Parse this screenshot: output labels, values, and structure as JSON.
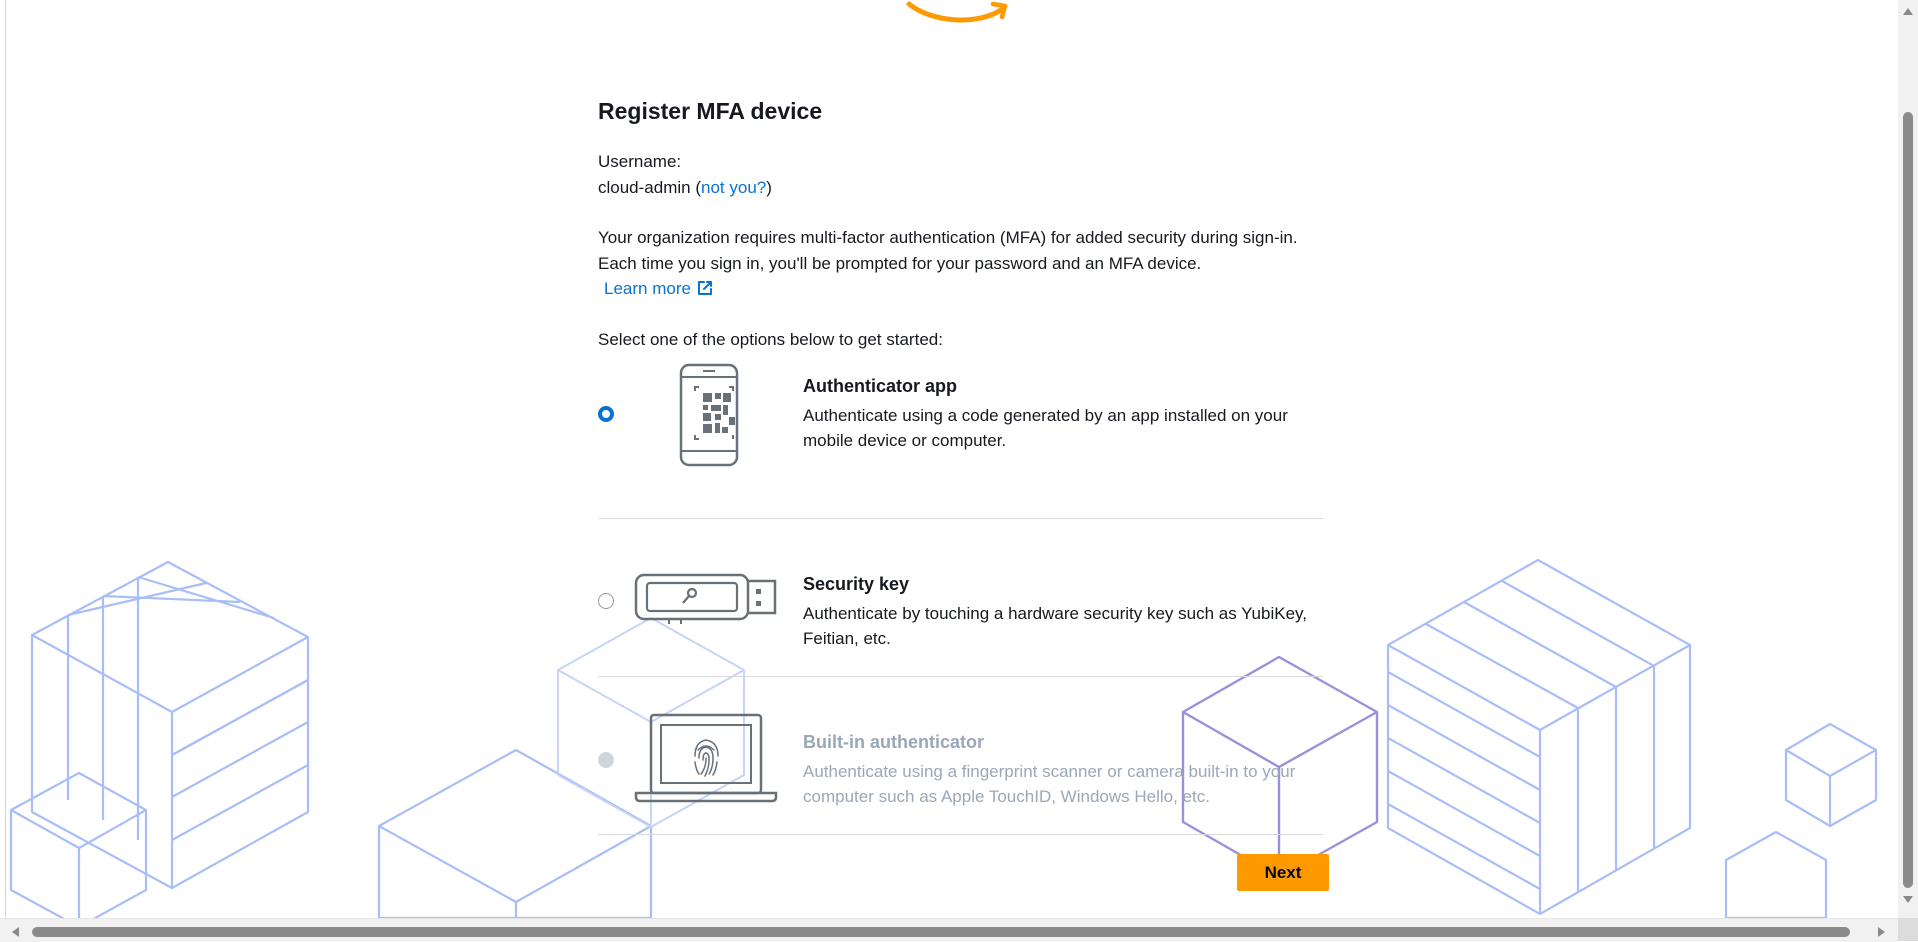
{
  "page": {
    "title": "Register MFA device",
    "username_label": "Username:",
    "username": "cloud-admin",
    "paren_open": "(",
    "not_you_link": "not you?",
    "paren_close": ")",
    "description": "Your organization requires multi-factor authentication (MFA) for added security during sign-in. Each time you sign in, you'll be prompted for your password and an MFA device.",
    "learn_more_link": "Learn more",
    "select_prompt": "Select one of the options below to get started:"
  },
  "options": [
    {
      "title": "Authenticator app",
      "description": "Authenticate using a code generated by an app installed on your mobile device or computer.",
      "selected": true,
      "enabled": true,
      "icon": "phone-qr-icon"
    },
    {
      "title": "Security key",
      "description": "Authenticate by touching a hardware security key such as YubiKey, Feitian, etc.",
      "selected": false,
      "enabled": true,
      "icon": "usb-key-icon"
    },
    {
      "title": "Built-in authenticator",
      "description": "Authenticate using a fingerprint scanner or camera built-in to your computer such as Apple TouchID, Windows Hello, etc.",
      "selected": false,
      "enabled": false,
      "icon": "laptop-fingerprint-icon"
    }
  ],
  "actions": {
    "next_label": "Next"
  },
  "colors": {
    "accent": "#0972d3",
    "primary_button": "#ff9900",
    "logo": "#ff9900",
    "background_art": "#a9bdf7"
  }
}
